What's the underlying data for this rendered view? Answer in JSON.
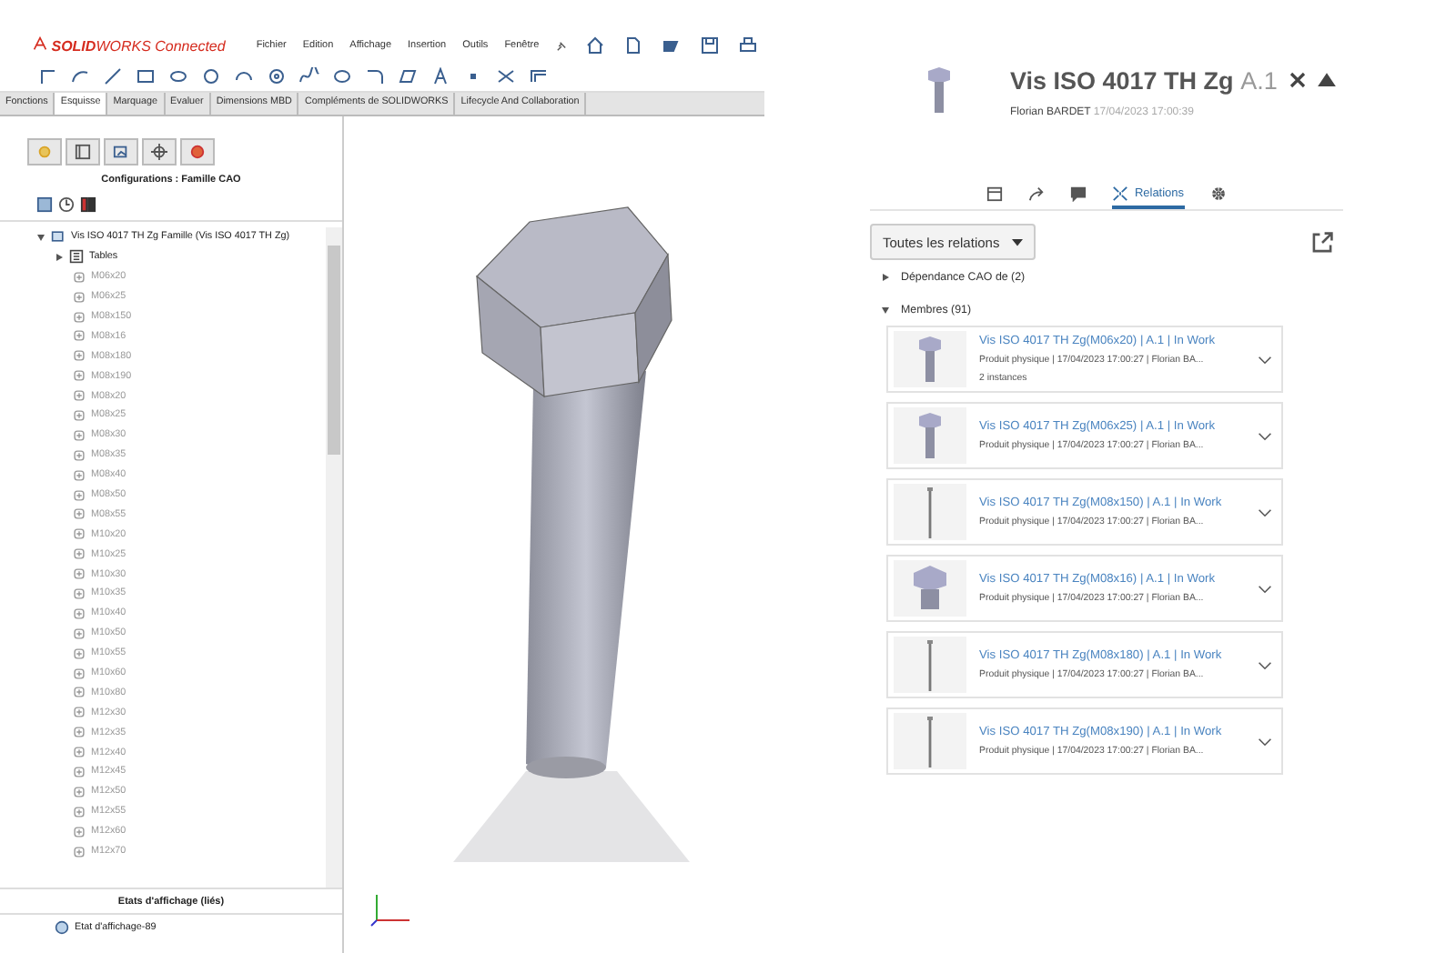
{
  "app": {
    "logo": "**SOLID**WORKS Connected",
    "menu": [
      "Fichier",
      "Edition",
      "Affichage",
      "Insertion",
      "Outils",
      "Fenêtre"
    ]
  },
  "command_tabs": [
    {
      "label": "Fonctions",
      "selected": false
    },
    {
      "label": "Esquisse",
      "selected": true
    },
    {
      "label": "Marquage",
      "selected": false
    },
    {
      "label": "Evaluer",
      "selected": false
    },
    {
      "label": "Dimensions MBD",
      "selected": false
    },
    {
      "label": "Compléments de SOLIDWORKS",
      "selected": false
    },
    {
      "label": "Lifecycle And Collaboration",
      "selected": false
    }
  ],
  "manager": {
    "title": "Configurations : Famille CAO",
    "root": {
      "label": "Vis ISO 4017 TH Zg Famille  (Vis ISO 4017 TH Zg)",
      "expanded": true,
      "children": [
        {
          "label": "Tables",
          "expanded": false
        }
      ]
    },
    "configurations": [
      "M06x20",
      "M06x25",
      "M08x150",
      "M08x16",
      "M08x180",
      "M08x190",
      "M08x20",
      "M08x25",
      "M08x30",
      "M08x35",
      "M08x40",
      "M08x50",
      "M08x55",
      "M10x20",
      "M10x25",
      "M10x30",
      "M10x35",
      "M10x40",
      "M10x50",
      "M10x55",
      "M10x60",
      "M10x80",
      "M12x30",
      "M12x35",
      "M12x40",
      "M12x45",
      "M12x50",
      "M12x55",
      "M12x60",
      "M12x70"
    ],
    "display_states_title": "Etats d'affichage (liés)",
    "display_state": "Etat d'affichage-89"
  },
  "panel": {
    "title": "Vis ISO 4017 TH Zg",
    "revision": "A.1",
    "author": "Florian BARDET",
    "date": "17/04/2023 17:00:39",
    "tabs": [
      {
        "kind": "calendar",
        "selected": false
      },
      {
        "kind": "share",
        "selected": false
      },
      {
        "kind": "comments",
        "selected": false
      },
      {
        "kind": "relations",
        "label": "Relations",
        "selected": true
      },
      {
        "kind": "settings",
        "selected": false
      }
    ],
    "filter": "Toutes les relations",
    "sections": [
      {
        "label": "Dépendance CAO de (2)",
        "expanded": false
      },
      {
        "label": "Membres (91)",
        "expanded": true
      }
    ],
    "members": [
      {
        "title": "Vis ISO 4017 TH Zg(M06x20) | A.1 | In Work",
        "details": "Produit physique | 17/04/2023 17:00:27 | Florian BA...",
        "instances": "2 instances",
        "kind": "hex"
      },
      {
        "title": "Vis ISO 4017 TH Zg(M06x25) | A.1 | In Work",
        "details": "Produit physique | 17/04/2023 17:00:27 | Florian BA...",
        "kind": "hex"
      },
      {
        "title": "Vis ISO 4017 TH Zg(M08x150) | A.1 | In Work",
        "details": "Produit physique | 17/04/2023 17:00:27 | Florian BA...",
        "kind": "rod"
      },
      {
        "title": "Vis ISO 4017 TH Zg(M08x16) | A.1 | In Work",
        "details": "Produit physique | 17/04/2023 17:00:27 | Florian BA...",
        "kind": "stub"
      },
      {
        "title": "Vis ISO 4017 TH Zg(M08x180) | A.1 | In Work",
        "details": "Produit physique | 17/04/2023 17:00:27 | Florian BA...",
        "kind": "rod"
      },
      {
        "title": "Vis ISO 4017 TH Zg(M08x190) | A.1 | In Work",
        "details": "Produit physique | 17/04/2023 17:00:27 | Florian BA...",
        "kind": "rod"
      }
    ]
  }
}
